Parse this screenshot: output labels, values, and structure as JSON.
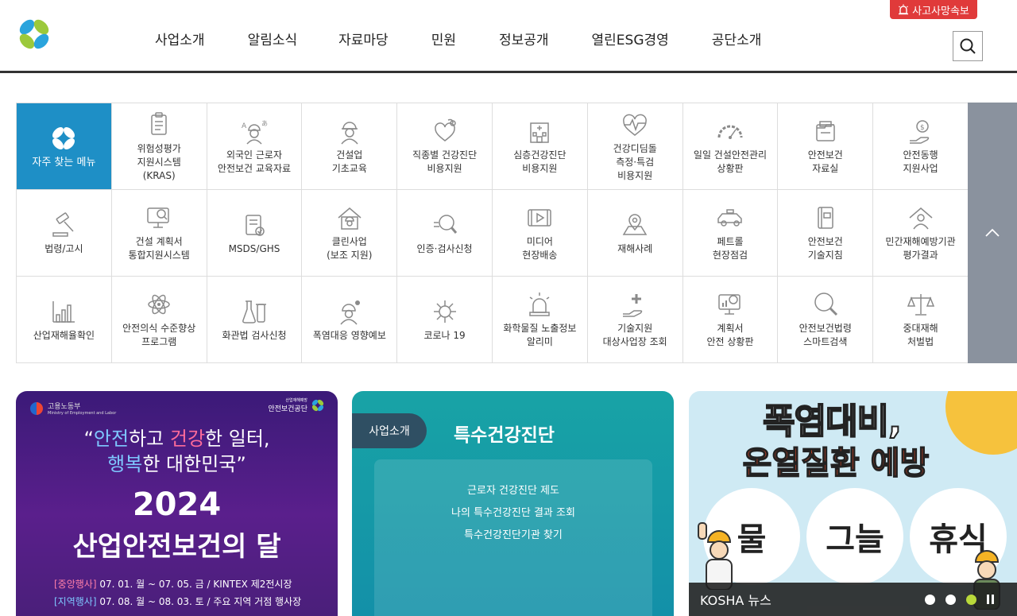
{
  "header": {
    "nav": [
      "사업소개",
      "알림소식",
      "자료마당",
      "민원",
      "정보공개",
      "열린ESG경영",
      "공단소개"
    ],
    "accident_label": "사고사망속보"
  },
  "quick_menu": {
    "featured_label": "자주 찾는 메뉴",
    "items": [
      {
        "label": "위험성평가\n지원시스템\n(KRAS)",
        "icon": "clipboard-icon"
      },
      {
        "label": "외국인 근로자\n안전보건 교육자료",
        "icon": "foreign-worker-icon"
      },
      {
        "label": "건설업\n기초교육",
        "icon": "construction-worker-icon"
      },
      {
        "label": "직종별 건강진단\n비용지원",
        "icon": "stethoscope-icon"
      },
      {
        "label": "심층건강진단\n비용지원",
        "icon": "hospital-icon"
      },
      {
        "label": "건강디딤돌\n측정·특검\n비용지원",
        "icon": "heartbeat-icon"
      },
      {
        "label": "일일 건설안전관리\n상황판",
        "icon": "gauge-icon"
      },
      {
        "label": "안전보건\n자료실",
        "icon": "folder-icon"
      },
      {
        "label": "안전동행\n지원사업",
        "icon": "money-hand-icon"
      },
      {
        "label": "법령/고시",
        "icon": "gavel-icon"
      },
      {
        "label": "건설 계획서\n통합지원시스템",
        "icon": "monitor-search-icon"
      },
      {
        "label": "MSDS/GHS",
        "icon": "checklist-icon"
      },
      {
        "label": "클린사업\n(보조 지원)",
        "icon": "house-worker-icon"
      },
      {
        "label": "인증·검사신청",
        "icon": "magnifier-icon"
      },
      {
        "label": "미디어\n현장배송",
        "icon": "video-icon"
      },
      {
        "label": "재해사례",
        "icon": "map-pin-icon"
      },
      {
        "label": "페트롤\n현장점검",
        "icon": "patrol-car-icon"
      },
      {
        "label": "안전보건\n기술지침",
        "icon": "book-icon"
      },
      {
        "label": "민간재해예방기관\n평가결과",
        "icon": "house-person-icon"
      },
      {
        "label": "산업재해율확인",
        "icon": "bar-chart-icon"
      },
      {
        "label": "안전의식 수준향상\n프로그램",
        "icon": "atom-icon"
      },
      {
        "label": "화관법 검사신청",
        "icon": "flask-icon"
      },
      {
        "label": "폭염대응 영향예보",
        "icon": "sun-worker-icon"
      },
      {
        "label": "코로나 19",
        "icon": "virus-icon"
      },
      {
        "label": "화학물질 노출정보\n알리미",
        "icon": "alarm-light-icon"
      },
      {
        "label": "기술지원\n대상사업장 조회",
        "icon": "hand-plus-icon"
      },
      {
        "label": "계획서\n안전 상황판",
        "icon": "monitor-chart-icon"
      },
      {
        "label": "안전보건법령\n스마트검색",
        "icon": "search-circle-icon"
      },
      {
        "label": "중대재해\n처벌법",
        "icon": "scales-icon"
      }
    ]
  },
  "banner1": {
    "ministry": "고용노동부",
    "ministry_en": "Ministry of Employment and Labor",
    "agency_small": "산업재해예방",
    "agency": "안전보건공단",
    "quote_line1_a": "“",
    "quote_hl1": "안전",
    "quote_mid1": "하고 ",
    "quote_hl2": "건강",
    "quote_rest1": "한 일터,",
    "quote_hl3": "행복",
    "quote_rest2": "한 대한민국”",
    "year": "2024",
    "title": "산업안전보건의 달",
    "tag1": "[중앙행사]",
    "event1": " 07. 01. 월 ~ 07. 05. 금 / KINTEX 제2전시장",
    "tag2": "[지역행사]",
    "event2": " 07. 08. 월 ~ 08. 03. 토 / 주요 지역 거점 행사장"
  },
  "banner2": {
    "tab": "사업소개",
    "title": "특수건강진단",
    "links": [
      "근로자 건강진단 제도",
      "나의 특수건강진단 결과 조회",
      "특수건강진단기관 찾기"
    ]
  },
  "banner3": {
    "headline1": "폭염대비,",
    "headline2": "온열질환 예방",
    "circles": [
      "물",
      "그늘",
      "휴식"
    ],
    "news_label": "KOSHA 뉴스"
  }
}
